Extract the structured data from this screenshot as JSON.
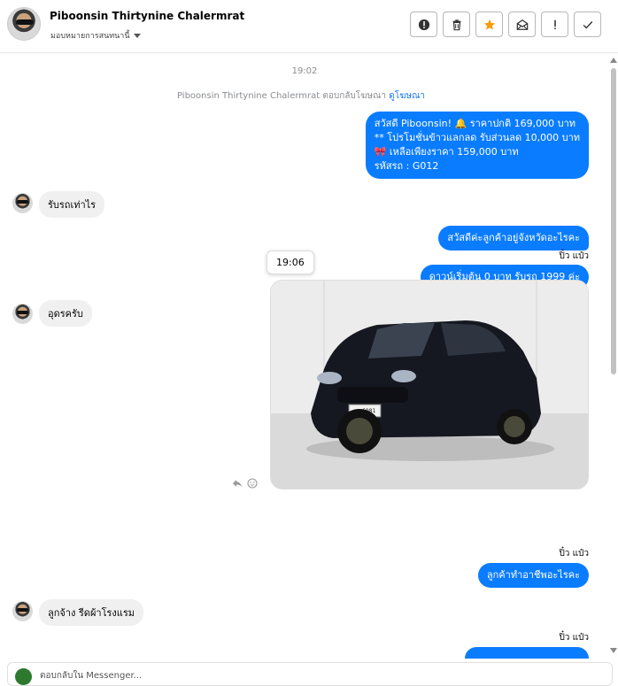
{
  "header": {
    "contact_name": "Piboonsin Thirtynine Chalermrat",
    "assign_label": "มอบหมายการสนทนานี้",
    "toolbar": [
      {
        "name": "alert-icon",
        "label": "Alert"
      },
      {
        "name": "trash-icon",
        "label": "Delete"
      },
      {
        "name": "star-icon",
        "label": "Star",
        "color": "#f59e0b"
      },
      {
        "name": "mail-icon",
        "label": "Mark unread"
      },
      {
        "name": "exclamation-icon",
        "label": "Spam"
      },
      {
        "name": "check-icon",
        "label": "Done"
      }
    ]
  },
  "chat": {
    "timestamp_top": "19:02",
    "ad_reply_prefix": "Piboonsin Thirtynine Chalermrat ตอบกลับโฆษณา",
    "ad_reply_link": "ดูโฆษณา",
    "messages": [
      {
        "side": "out",
        "lines": [
          "สวัสดี Piboonsin! 🔔 ราคาปกติ 169,000 บาท",
          "** โปรโมชั่นข้าวแลกลด รับส่วนลด 10,000 บาท",
          "🎀 เหลือเพียงราคา 159,000 บาท",
          "รหัสรถ : G012"
        ]
      },
      {
        "side": "in",
        "text": "รับรถเท่าไร"
      },
      {
        "side": "out",
        "text": "สวัสดีค่ะลูกค้าอยู่จังหวัดอะไรคะ"
      },
      {
        "side": "sender",
        "text": "ปิ๋ว แป๋ว"
      },
      {
        "side": "out",
        "text": "ดาวน์เริ่มต้น 0 บาท รับรถ 1999 ค่ะ"
      },
      {
        "side": "in",
        "text": "อุดรครับ"
      },
      {
        "side": "sender",
        "text": "ปิ๋ว แป๋ว"
      },
      {
        "side": "out",
        "text": "ลูกค้าทำอาชีพอะไรคะ"
      },
      {
        "side": "in",
        "text": "ลูกจ้าง รีดผ้าโรงแรม"
      },
      {
        "side": "sender",
        "text": "ปิ๋ว แป๋ว"
      }
    ],
    "tooltip_time": "19:06",
    "photo_plate": "มส 6981"
  },
  "composer": {
    "placeholder": "ตอบกลับใน Messenger..."
  },
  "colors": {
    "outgoing_bubble": "#0a7cff",
    "incoming_bubble": "#f0f0f0",
    "link": "#1877f2"
  }
}
